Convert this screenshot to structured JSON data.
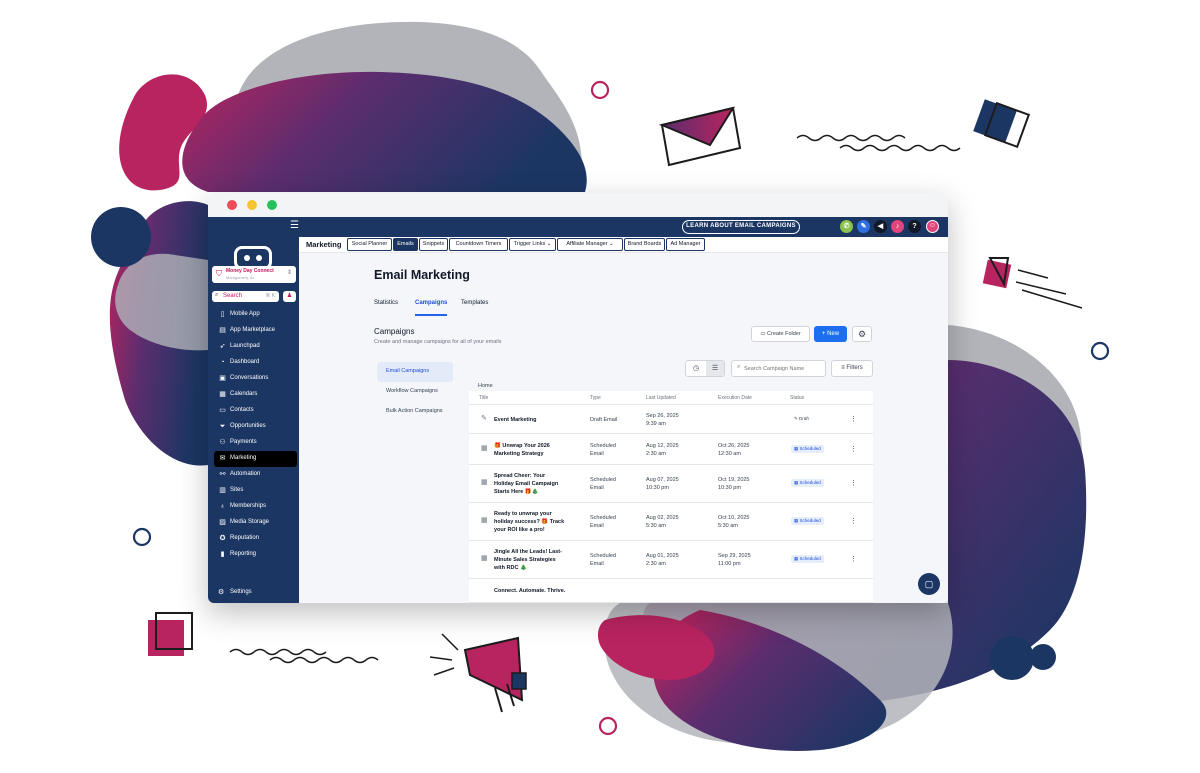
{
  "topbar": {
    "learn_button": "LEARN ABOUT EMAIL CAMPAIGNS",
    "icons": [
      "phone-icon",
      "magic-icon",
      "megaphone-icon",
      "bell-icon",
      "help-icon",
      "user-icon"
    ],
    "help_label": "?"
  },
  "sidebar": {
    "account_name": "Money Day Connect",
    "account_location": "Montgomery, AL",
    "search_label": "Search",
    "search_shortcut": "⌘ K",
    "items": [
      {
        "label": "Mobile App",
        "icon": "mobile-icon"
      },
      {
        "label": "App Marketplace",
        "icon": "marketplace-icon"
      },
      {
        "label": "Launchpad",
        "icon": "rocket-icon"
      },
      {
        "label": "Dashboard",
        "icon": "dashboard-icon"
      },
      {
        "label": "Conversations",
        "icon": "chat-icon"
      },
      {
        "label": "Calendars",
        "icon": "calendar-icon"
      },
      {
        "label": "Contacts",
        "icon": "contacts-icon"
      },
      {
        "label": "Opportunities",
        "icon": "filter-icon"
      },
      {
        "label": "Payments",
        "icon": "payments-icon"
      },
      {
        "label": "Marketing",
        "icon": "mail-icon",
        "active": true
      },
      {
        "label": "Automation",
        "icon": "automation-icon"
      },
      {
        "label": "Sites",
        "icon": "sites-icon"
      },
      {
        "label": "Memberships",
        "icon": "membership-icon"
      },
      {
        "label": "Media Storage",
        "icon": "media-icon"
      },
      {
        "label": "Reputation",
        "icon": "reputation-icon"
      },
      {
        "label": "Reporting",
        "icon": "reporting-icon"
      }
    ],
    "settings_label": "Settings"
  },
  "subnav": {
    "section": "Marketing",
    "tabs": [
      {
        "label": "Social Planner"
      },
      {
        "label": "Emails",
        "active": true
      },
      {
        "label": "Snippets"
      },
      {
        "label": "Countdown Timers"
      },
      {
        "label": "Trigger Links ⌄"
      },
      {
        "label": "Affiliate Manager ⌄"
      },
      {
        "label": "Brand Boards"
      },
      {
        "label": "Ad Manager"
      }
    ]
  },
  "main": {
    "title": "Email Marketing",
    "tabs": [
      {
        "label": "Statistics"
      },
      {
        "label": "Campaigns",
        "active": true
      },
      {
        "label": "Templates"
      }
    ],
    "section_title": "Campaigns",
    "section_subtitle": "Create and manage campaigns for all of your emails",
    "create_folder_label": "Create Folder",
    "new_label": "+ New",
    "left_nav": [
      {
        "label": "Email Campaigns",
        "active": true
      },
      {
        "label": "Workflow Campaigns"
      },
      {
        "label": "Bulk Action Campaigns"
      }
    ],
    "search_placeholder": "Search Campaign Name",
    "filters_label": "Filters",
    "breadcrumb": "Home",
    "table": {
      "headers": [
        "Title",
        "Type",
        "Last Updated",
        "Execution Date",
        "Status"
      ],
      "rows": [
        {
          "title": [
            "Event Marketing"
          ],
          "type": [
            "Draft Email"
          ],
          "updated": [
            "Sep 26, 2025",
            "9:39 am"
          ],
          "execution": [],
          "status": "Draft",
          "status_kind": "draft",
          "icon": "edit-icon"
        },
        {
          "title": [
            "🎁 Unwrap Your 2026",
            "Marketing Strategy"
          ],
          "type": [
            "Scheduled",
            "Email"
          ],
          "updated": [
            "Aug 12, 2025",
            "2:30 am"
          ],
          "execution": [
            "Oct 26, 2025",
            "12:30 am"
          ],
          "status": "Scheduled",
          "status_kind": "scheduled",
          "icon": "calendar-icon"
        },
        {
          "title": [
            "Spread Cheer: Your",
            "Holiday Email Campaign",
            "Starts Here 🎁🎄"
          ],
          "type": [
            "Scheduled",
            "Email"
          ],
          "updated": [
            "Aug 07, 2025",
            "10:30 pm"
          ],
          "execution": [
            "Oct 19, 2025",
            "10:30 pm"
          ],
          "status": "Scheduled",
          "status_kind": "scheduled",
          "icon": "calendar-icon"
        },
        {
          "title": [
            "Ready to unwrap your",
            "holiday success? 🎁 Track",
            "your ROI like a pro!"
          ],
          "type": [
            "Scheduled",
            "Email"
          ],
          "updated": [
            "Aug 02, 2025",
            "5:30 am"
          ],
          "execution": [
            "Oct 10, 2025",
            "5:30 am"
          ],
          "status": "Scheduled",
          "status_kind": "scheduled",
          "icon": "calendar-icon"
        },
        {
          "title": [
            "Jingle All the Leads! Last-",
            "Minute Sales Strategies",
            "with RDC 🎄"
          ],
          "type": [
            "Scheduled",
            "Email"
          ],
          "updated": [
            "Aug 01, 2025",
            "2:30 am"
          ],
          "execution": [
            "Sep 29, 2025",
            "11:00 pm"
          ],
          "status": "Scheduled",
          "status_kind": "scheduled",
          "icon": "calendar-icon"
        },
        {
          "title": [
            "Connect. Automate. Thrive."
          ],
          "type": [],
          "updated": [],
          "execution": [],
          "status": "",
          "status_kind": "",
          "icon": ""
        }
      ]
    }
  },
  "colors": {
    "navy": "#1c3664",
    "accent_blue": "#1d6ff0",
    "magenta": "#b8245f",
    "purple": "#5b2d6e"
  }
}
